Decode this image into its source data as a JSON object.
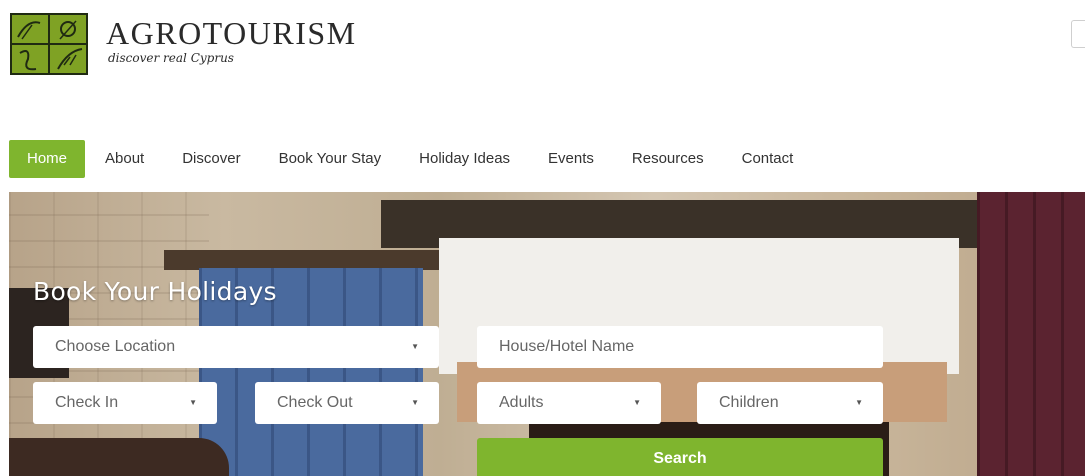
{
  "brand": {
    "name": "AGROTOURISM",
    "tagline": "discover real Cyprus",
    "colors": {
      "accent": "#7fb52e",
      "logo_dark": "#1f2a12"
    }
  },
  "nav": {
    "items": [
      {
        "label": "Home",
        "active": true
      },
      {
        "label": "About"
      },
      {
        "label": "Discover"
      },
      {
        "label": "Book Your Stay"
      },
      {
        "label": "Holiday Ideas"
      },
      {
        "label": "Events"
      },
      {
        "label": "Resources"
      },
      {
        "label": "Contact"
      }
    ]
  },
  "booking": {
    "title": "Book Your Holidays",
    "location": {
      "value": "Choose Location"
    },
    "hotel": {
      "placeholder": "House/Hotel Name"
    },
    "check_in": {
      "value": "Check In"
    },
    "check_out": {
      "value": "Check Out"
    },
    "adults": {
      "value": "Adults"
    },
    "children": {
      "value": "Children"
    },
    "search_label": "Search",
    "caret_icon": "▼"
  }
}
